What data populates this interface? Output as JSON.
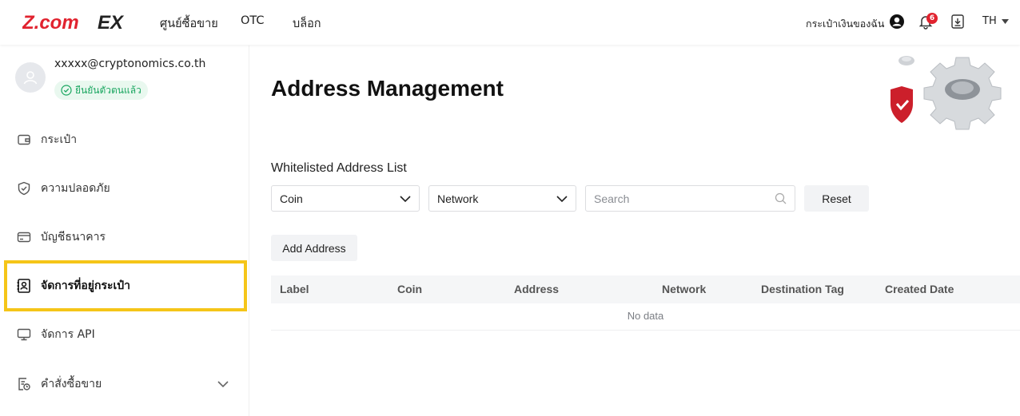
{
  "brand": {
    "logo_text": "Z.comEX",
    "accent": "#e1232f"
  },
  "nav": {
    "links": [
      "ศูนย์ซื้อขาย",
      "OTC",
      "บล็อก"
    ],
    "wallet": "กระเป๋าเงินของฉัน",
    "notification_count": "6",
    "language": "TH"
  },
  "user": {
    "email": "xxxxx@cryptonomics.co.th",
    "verified_label": "ยืนยันตัวตนแล้ว"
  },
  "sidebar": {
    "items": [
      {
        "label": "กระเป๋า",
        "icon": "wallet-icon"
      },
      {
        "label": "ความปลอดภัย",
        "icon": "shield-icon"
      },
      {
        "label": "บัญชีธนาคาร",
        "icon": "bank-card-icon"
      },
      {
        "label": "จัดการที่อยู่กระเป๋า",
        "icon": "address-book-icon",
        "active": true
      },
      {
        "label": "จัดการ API",
        "icon": "monitor-icon"
      },
      {
        "label": "คำสั่งซื้อขาย",
        "icon": "orders-icon",
        "expandable": true
      }
    ],
    "active_color": "#f5c518"
  },
  "main": {
    "title": "Address Management",
    "section_title": "Whitelisted Address List",
    "filters": {
      "coin": "Coin",
      "network": "Network",
      "search_placeholder": "Search",
      "reset": "Reset"
    },
    "add_button": "Add Address",
    "table": {
      "columns": [
        "Label",
        "Coin",
        "Address",
        "Network",
        "Destination Tag",
        "Created Date"
      ],
      "empty_text": "No data"
    }
  }
}
